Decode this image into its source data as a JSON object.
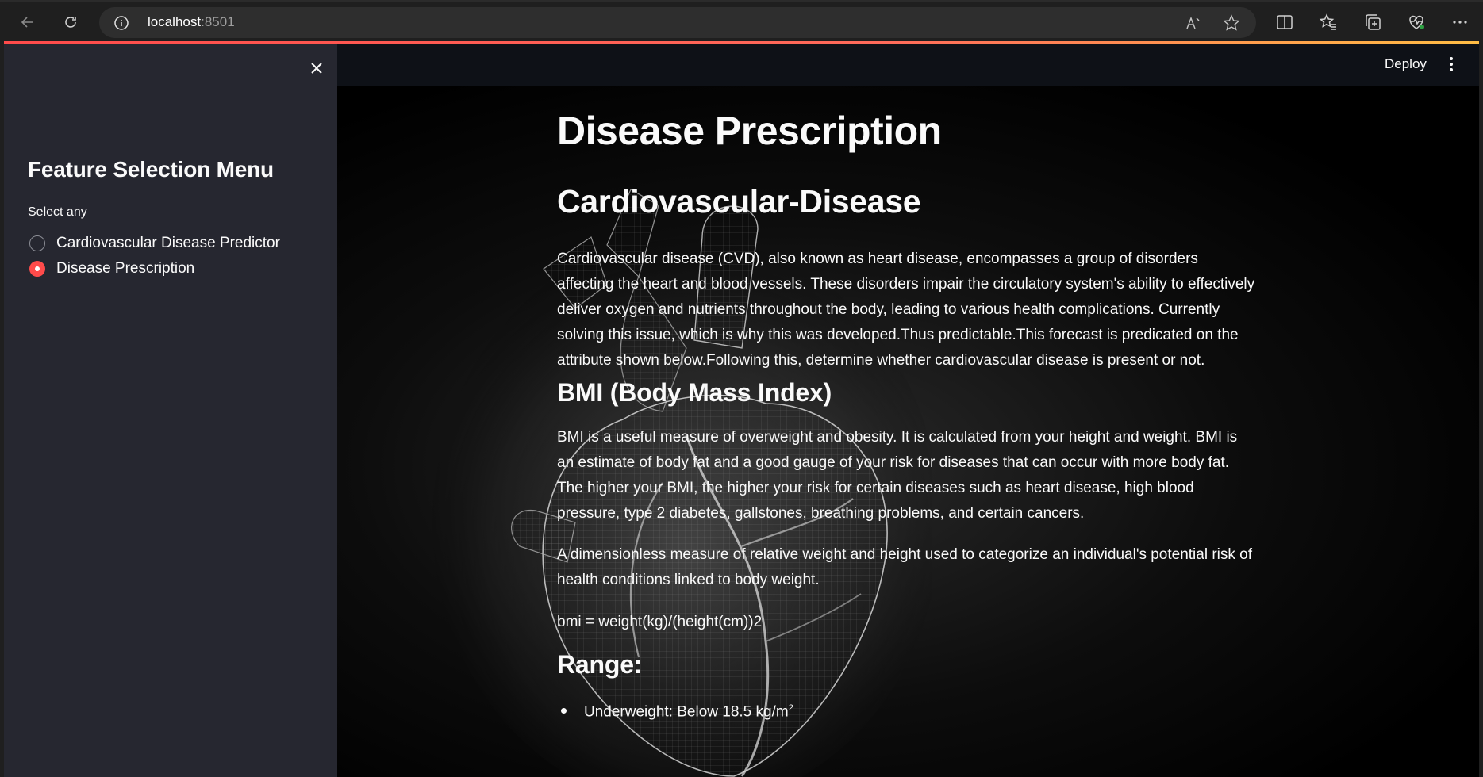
{
  "browser": {
    "url_host": "localhost",
    "url_port": ":8501"
  },
  "sidebar": {
    "title": "Feature Selection Menu",
    "radio_caption": "Select any",
    "options": [
      {
        "label": "Cardiovascular Disease Predictor",
        "selected": false
      },
      {
        "label": "Disease Prescription",
        "selected": true
      }
    ]
  },
  "header": {
    "deploy_label": "Deploy"
  },
  "main": {
    "title": "Disease Prescription",
    "cvd_heading": "Cardiovascular-Disease",
    "cvd_text": "Cardiovascular disease (CVD), also known as heart disease, encompasses a group of disorders affecting the heart and blood vessels. These disorders impair the circulatory system's ability to effectively deliver oxygen and nutrients throughout the body, leading to various health complications. Currently solving this issue, which is why this was developed.Thus predictable.This forecast is predicated on the attribute shown below.Following this, determine whether cardiovascular disease is present or not.",
    "bmi_heading": "BMI (Body Mass Index)",
    "bmi_text_1": "BMI is a useful measure of overweight and obesity. It is calculated from your height and weight. BMI is an estimate of body fat and a good gauge of your risk for diseases that can occur with more body fat. The higher your BMI, the higher your risk for certain diseases such as heart disease, high blood pressure, type 2 diabetes, gallstones, breathing problems, and certain cancers.",
    "bmi_text_2": "A dimensionless measure of relative weight and height used to categorize an individual's potential risk of health conditions linked to body weight.",
    "bmi_formula": "bmi = weight(kg)/(height(cm))2",
    "range_heading": "Range:",
    "range_items": [
      {
        "text": "Underweight: Below 18.5 kg/m",
        "sup": "2"
      }
    ]
  },
  "colors": {
    "accent": "#ff4b4b",
    "sidebar_bg": "#262730",
    "app_bg": "#0e1117"
  }
}
